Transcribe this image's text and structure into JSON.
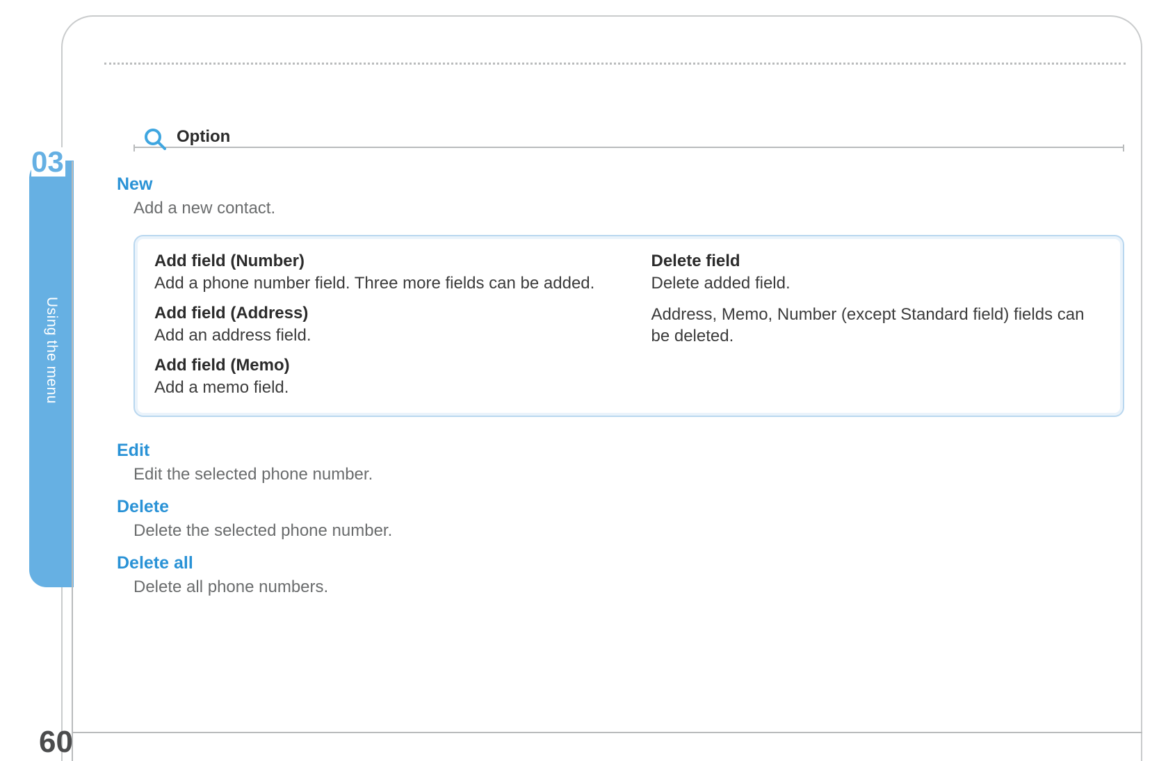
{
  "page": {
    "chapter_number": "03",
    "side_label": "Using the menu",
    "page_number": "60"
  },
  "option": {
    "heading": "Option"
  },
  "sections": {
    "new": {
      "title": "New",
      "desc": "Add a new contact."
    },
    "edit": {
      "title": "Edit",
      "desc": "Edit the selected phone number."
    },
    "delete": {
      "title": "Delete",
      "desc": "Delete the selected phone number."
    },
    "delete_all": {
      "title": "Delete all",
      "desc": "Delete all phone numbers."
    }
  },
  "callout": {
    "items": [
      {
        "title": "Add field (Number)",
        "desc": "Add a phone number field. Three more fields can be added."
      },
      {
        "title": "Add field (Address)",
        "desc": "Add an address field."
      },
      {
        "title": "Add field (Memo)",
        "desc": "Add a memo field."
      },
      {
        "title": "Delete field",
        "desc": "Delete added field."
      }
    ],
    "note": "Address, Memo, Number (except Standard field) fields can be deleted."
  }
}
